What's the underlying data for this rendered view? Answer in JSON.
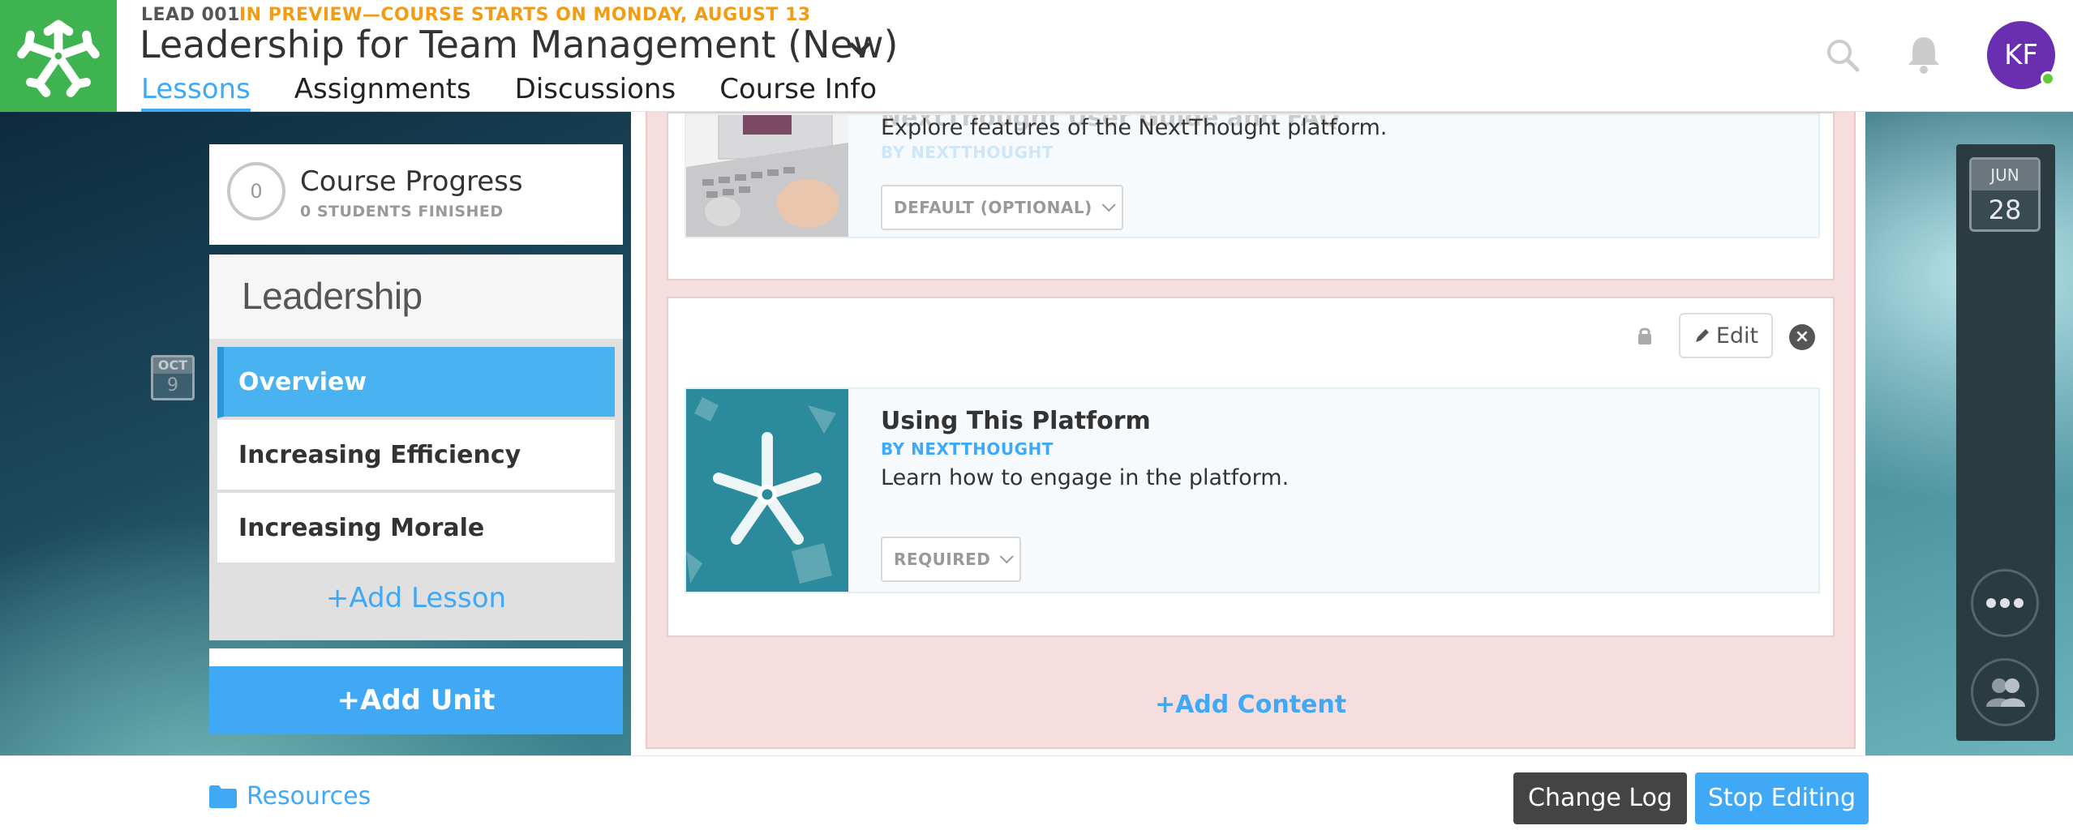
{
  "header": {
    "course_code": "LEAD 001",
    "preview_note": "IN PREVIEW—COURSE STARTS ON MONDAY, AUGUST 13",
    "course_title": "Leadership for Team Management (New)",
    "tabs": [
      {
        "label": "Lessons",
        "active": true
      },
      {
        "label": "Assignments",
        "active": false
      },
      {
        "label": "Discussions",
        "active": false
      },
      {
        "label": "Course Info",
        "active": false
      }
    ],
    "avatar_initials": "KF",
    "icons": [
      "search-icon",
      "bell-icon"
    ]
  },
  "progress": {
    "count": "0",
    "title": "Course Progress",
    "subtitle": "0 STUDENTS FINISHED"
  },
  "unit": {
    "title": "Leadership",
    "lessons": [
      {
        "label": "Overview",
        "active": true
      },
      {
        "label": "Increasing Efficiency",
        "active": false
      },
      {
        "label": "Increasing Morale",
        "active": false
      }
    ],
    "add_lesson": "+Add Lesson",
    "add_unit": "+Add Unit"
  },
  "date_badge": {
    "month": "OCT",
    "day": "9"
  },
  "content": {
    "items": [
      {
        "title": "NextThought User Guide and FAQ",
        "author": "BY NEXTTHOUGHT",
        "description": "Explore features of the NextThought platform.",
        "requirement": "DEFAULT (OPTIONAL)"
      },
      {
        "title": "Using This Platform",
        "author": "BY NEXTTHOUGHT",
        "description": "Learn how to engage in the platform.",
        "requirement": "REQUIRED"
      }
    ],
    "edit_label": "Edit",
    "add_content": "+Add Content"
  },
  "sidebar": {
    "calendar": {
      "month": "JUN",
      "day": "28"
    },
    "icons": [
      "more-icon",
      "contacts-icon"
    ]
  },
  "footer": {
    "resources": "Resources",
    "change_log": "Change Log",
    "stop_editing": "Stop Editing"
  },
  "colors": {
    "brand_green": "#3fb34f",
    "accent_blue": "#3fa9f5",
    "preview_orange": "#f39c12",
    "avatar_purple": "#6a2fb0"
  }
}
